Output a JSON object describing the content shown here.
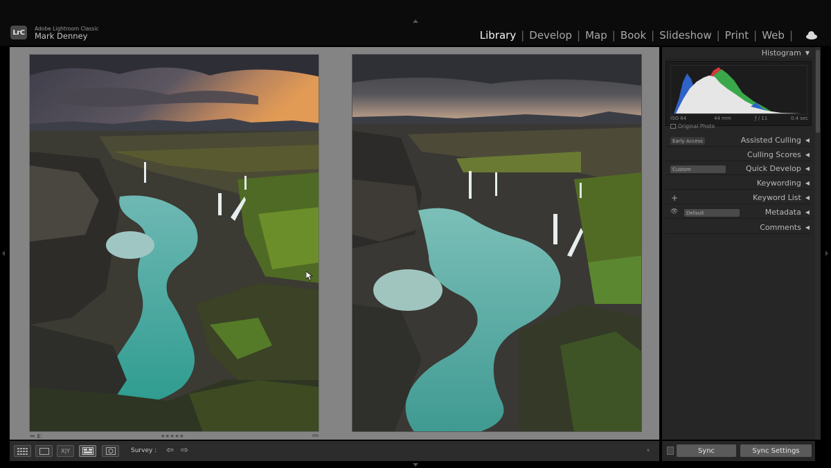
{
  "identity": {
    "logo": "LrC",
    "app_name": "Adobe Lightroom Classic",
    "user_name": "Mark Denney"
  },
  "modules": [
    {
      "label": "Library",
      "active": true
    },
    {
      "label": "Develop",
      "active": false
    },
    {
      "label": "Map",
      "active": false
    },
    {
      "label": "Book",
      "active": false
    },
    {
      "label": "Slideshow",
      "active": false
    },
    {
      "label": "Print",
      "active": false
    },
    {
      "label": "Web",
      "active": false
    }
  ],
  "separator": "|",
  "icons": {
    "cloud": "cloud-icon",
    "close": "close-icon",
    "cursor": "pointer-cursor-icon",
    "grid": "grid-view-icon",
    "loupe": "loupe-view-icon",
    "compare": "compare-view-icon",
    "survey": "survey-view-icon",
    "people": "people-view-icon"
  },
  "select_photo": {
    "close_glyph": "✕",
    "flag_glyph": "▬ ◧",
    "stars": "★★★★★"
  },
  "histogram": {
    "title": "Histogram",
    "exif": {
      "iso": "ISO 64",
      "focal": "44 mm",
      "aperture": "ƒ / 11",
      "shutter": "0.4 sec"
    },
    "original_photo_label": "Original Photo",
    "colors": {
      "blue": "#2f63c8",
      "green": "#3aa84a",
      "red": "#d23a3a",
      "white": "#e6e6e6",
      "background": "#1c1c1c"
    }
  },
  "panels": {
    "assisted_culling": {
      "label": "Assisted Culling",
      "badge": "Early Access"
    },
    "culling_scores": {
      "label": "Culling Scores"
    },
    "quick_develop": {
      "label": "Quick Develop",
      "preset": "Custom"
    },
    "keywording": {
      "label": "Keywording"
    },
    "keyword_list": {
      "label": "Keyword List",
      "plus": "+"
    },
    "metadata": {
      "label": "Metadata",
      "preset": "Default",
      "eye": "👁"
    },
    "comments": {
      "label": "Comments"
    }
  },
  "panel_collapse_glyph": "◀",
  "panel_expand_glyph": "▼",
  "toolbar": {
    "survey_label": "Survey :",
    "compare_glyph": "X|Y",
    "prev_glyph": "⇦",
    "next_glyph": "⇨",
    "menu_glyph": "▾"
  },
  "sync": {
    "sync_label": "Sync",
    "sync_settings_label": "Sync Settings"
  }
}
